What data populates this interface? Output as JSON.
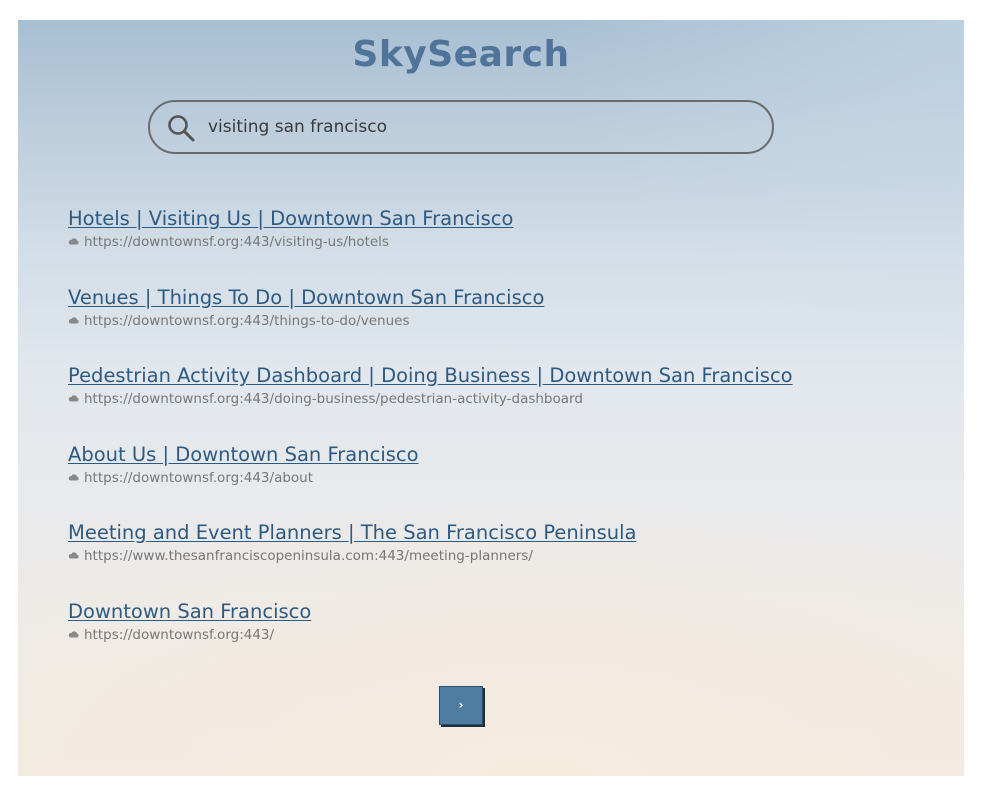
{
  "app": {
    "logo": "SkySearch"
  },
  "search": {
    "query": "visiting san francisco",
    "icon": "search-icon"
  },
  "results": [
    {
      "title": "Hotels | Visiting Us | Downtown San Francisco",
      "url": "https://downtownsf.org:443/visiting-us/hotels"
    },
    {
      "title": "Venues | Things To Do | Downtown San Francisco",
      "url": "https://downtownsf.org:443/things-to-do/venues"
    },
    {
      "title": "Pedestrian Activity Dashboard | Doing Business | Downtown San Francisco",
      "url": "https://downtownsf.org:443/doing-business/pedestrian-activity-dashboard"
    },
    {
      "title": "About Us | Downtown San Francisco",
      "url": "https://downtownsf.org:443/about"
    },
    {
      "title": "Meeting and Event Planners | The San Francisco Peninsula",
      "url": "https://www.thesanfranciscopeninsula.com:443/meeting-planners/"
    },
    {
      "title": "Downtown San Francisco",
      "url": "https://downtownsf.org:443/"
    }
  ],
  "pagination": {
    "next_label": "›"
  },
  "colors": {
    "logo": "#4f7399",
    "link": "#2d5a82",
    "url": "#777777",
    "button": "#4d7da2"
  }
}
